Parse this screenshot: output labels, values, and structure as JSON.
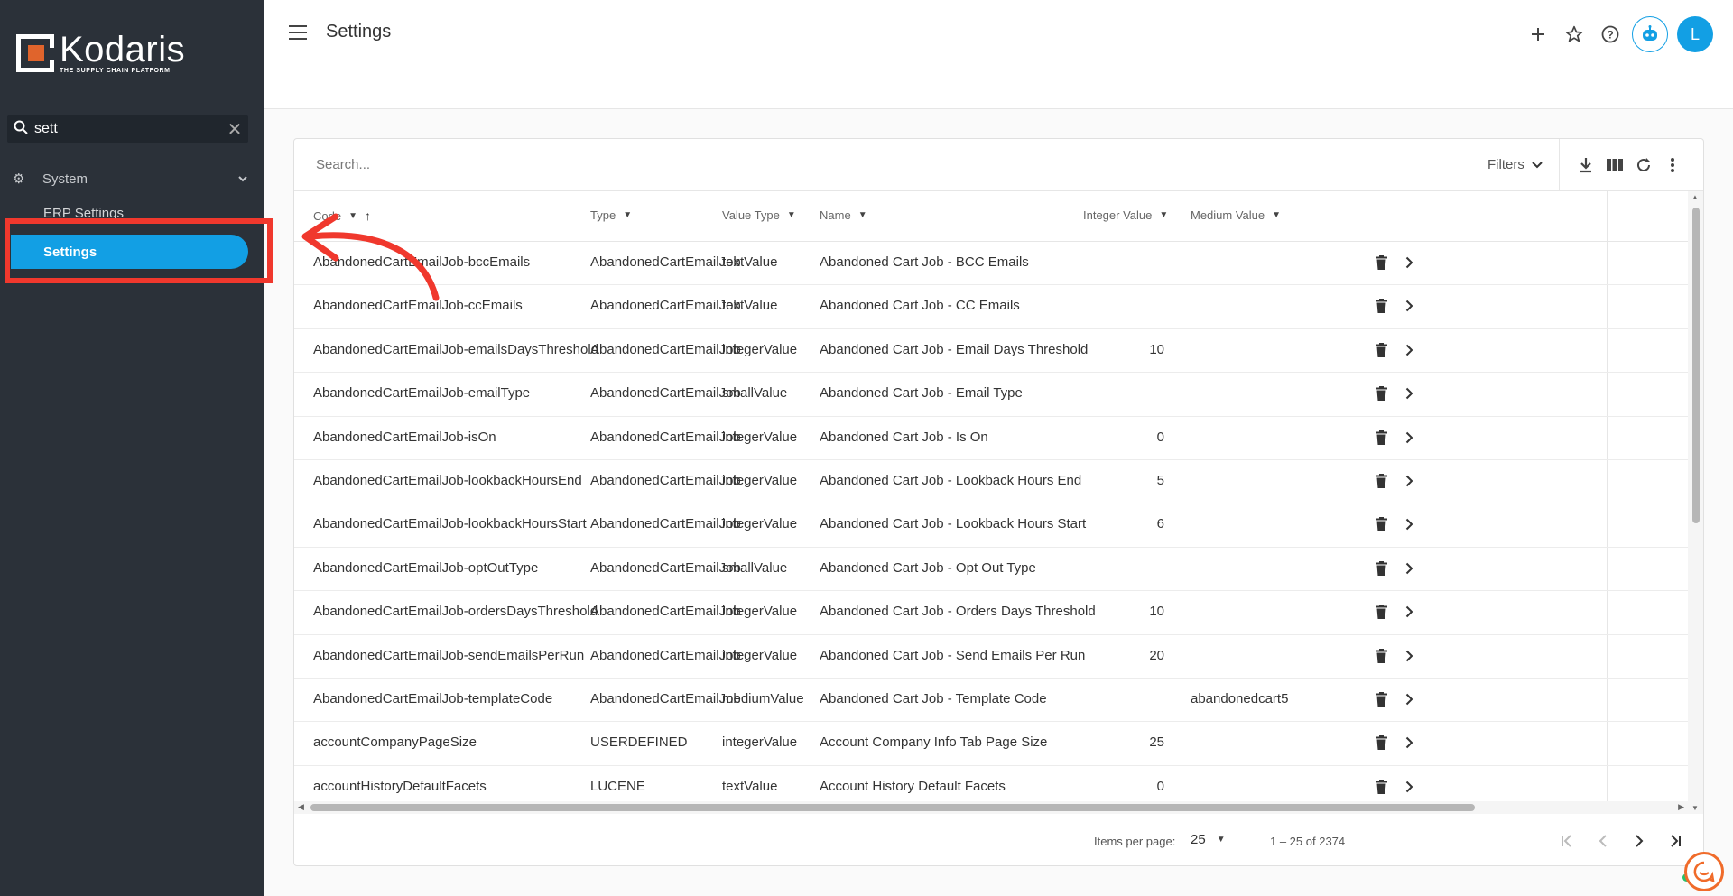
{
  "app": {
    "brand": "Kodaris",
    "tagline": "THE SUPPLY CHAIN PLATFORM",
    "page_title": "Settings"
  },
  "sidebar": {
    "search_value": "sett",
    "group": "System",
    "items": [
      {
        "label": "ERP Settings"
      },
      {
        "label": "Settings",
        "active": true
      }
    ]
  },
  "header": {
    "avatar_letter": "L",
    "icons": [
      "plus-icon",
      "star-icon",
      "help-icon",
      "assistant-bot-icon"
    ]
  },
  "table": {
    "search_placeholder": "Search...",
    "filters_label": "Filters",
    "columns": [
      "Code",
      "Type",
      "Value Type",
      "Name",
      "Integer Value",
      "Medium Value"
    ],
    "rows": [
      {
        "code": "AbandonedCartEmailJob-bccEmails",
        "type": "AbandonedCartEmailJob",
        "value_type": "textValue",
        "name": "Abandoned Cart Job - BCC Emails",
        "int": "",
        "medium": ""
      },
      {
        "code": "AbandonedCartEmailJob-ccEmails",
        "type": "AbandonedCartEmailJob",
        "value_type": "textValue",
        "name": "Abandoned Cart Job - CC Emails",
        "int": "",
        "medium": ""
      },
      {
        "code": "AbandonedCartEmailJob-emailsDaysThreshold",
        "type": "AbandonedCartEmailJob",
        "value_type": "integerValue",
        "name": "Abandoned Cart Job - Email Days Threshold",
        "int": "10",
        "medium": ""
      },
      {
        "code": "AbandonedCartEmailJob-emailType",
        "type": "AbandonedCartEmailJob",
        "value_type": "smallValue",
        "name": "Abandoned Cart Job - Email Type",
        "int": "",
        "medium": ""
      },
      {
        "code": "AbandonedCartEmailJob-isOn",
        "type": "AbandonedCartEmailJob",
        "value_type": "integerValue",
        "name": "Abandoned Cart Job - Is On",
        "int": "0",
        "medium": ""
      },
      {
        "code": "AbandonedCartEmailJob-lookbackHoursEnd",
        "type": "AbandonedCartEmailJob",
        "value_type": "integerValue",
        "name": "Abandoned Cart Job - Lookback Hours End",
        "int": "5",
        "medium": ""
      },
      {
        "code": "AbandonedCartEmailJob-lookbackHoursStart",
        "type": "AbandonedCartEmailJob",
        "value_type": "integerValue",
        "name": "Abandoned Cart Job - Lookback Hours Start",
        "int": "6",
        "medium": ""
      },
      {
        "code": "AbandonedCartEmailJob-optOutType",
        "type": "AbandonedCartEmailJob",
        "value_type": "smallValue",
        "name": "Abandoned Cart Job - Opt Out Type",
        "int": "",
        "medium": ""
      },
      {
        "code": "AbandonedCartEmailJob-ordersDaysThreshold",
        "type": "AbandonedCartEmailJob",
        "value_type": "integerValue",
        "name": "Abandoned Cart Job - Orders Days Threshold",
        "int": "10",
        "medium": ""
      },
      {
        "code": "AbandonedCartEmailJob-sendEmailsPerRun",
        "type": "AbandonedCartEmailJob",
        "value_type": "integerValue",
        "name": "Abandoned Cart Job - Send Emails Per Run",
        "int": "20",
        "medium": ""
      },
      {
        "code": "AbandonedCartEmailJob-templateCode",
        "type": "AbandonedCartEmailJob",
        "value_type": "mediumValue",
        "name": "Abandoned Cart Job - Template Code",
        "int": "",
        "medium": "abandonedcart5"
      },
      {
        "code": "accountCompanyPageSize",
        "type": "USERDEFINED",
        "value_type": "integerValue",
        "name": "Account Company Info Tab Page Size",
        "int": "25",
        "medium": ""
      },
      {
        "code": "accountHistoryDefaultFacets",
        "type": "LUCENE",
        "value_type": "textValue",
        "name": "Account History Default Facets",
        "int": "0",
        "medium": ""
      }
    ]
  },
  "pagination": {
    "items_per_page_label": "Items per page:",
    "items_per_page": "25",
    "range": "1 – 25 of 2374"
  },
  "colors": {
    "sidebar_bg": "#2b3139",
    "accent": "#129fe4",
    "brand_orange": "#e0642c",
    "annotation_red": "#f0382d"
  }
}
